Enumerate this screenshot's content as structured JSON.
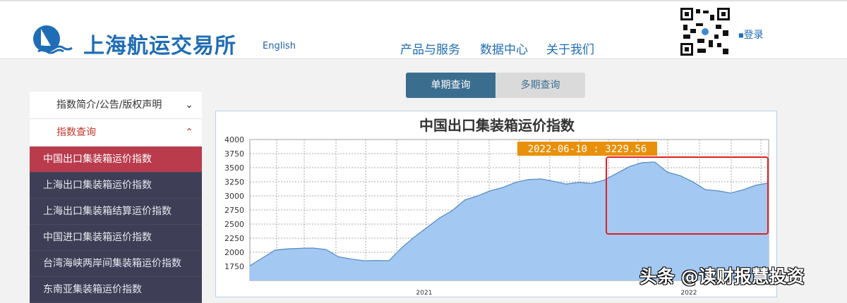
{
  "header": {
    "brand": "上海航运交易所",
    "english": "English",
    "nav": [
      "产品与服务",
      "数据中心",
      "关于我们"
    ],
    "login": "登录"
  },
  "tabs": [
    {
      "label": "单期查询",
      "active": true
    },
    {
      "label": "多期查询",
      "active": false
    }
  ],
  "sidebar": {
    "sections": [
      {
        "label": "指数简介/公告/版权声明",
        "expanded": false
      },
      {
        "label": "指数查询",
        "expanded": true
      }
    ],
    "items": [
      "中国出口集装箱运价指数",
      "上海出口集装箱运价指数",
      "上海出口集装箱结算运价指数",
      "中国进口集装箱运价指数",
      "台湾海峡两岸间集装箱运价指数",
      "东南亚集装箱运价指数"
    ],
    "active_index": 0
  },
  "colors": {
    "accent": "#1f6db5",
    "active_tab": "#3b6e8e",
    "sidebar_active": "#b93b4c",
    "sidebar_bg": "#3e3f57",
    "area_fill": "#a3c8f2",
    "tooltip": "#e8900c",
    "highlight": "#e02020"
  },
  "chart_data": {
    "type": "area",
    "title": "中国出口集装箱运价指数",
    "ylim": [
      1700,
      4000
    ],
    "yticks": [
      1750,
      2000,
      2250,
      2500,
      2750,
      3000,
      3250,
      3500,
      3750,
      4000
    ],
    "xtick_labels": [
      "2021",
      "2022"
    ],
    "tooltip": "2022-06-10 : 3229.56",
    "values": [
      1760,
      1900,
      2040,
      2060,
      2070,
      2075,
      2050,
      1920,
      1880,
      1850,
      1855,
      1850,
      2080,
      2270,
      2440,
      2610,
      2740,
      2930,
      3000,
      3090,
      3150,
      3240,
      3290,
      3300,
      3260,
      3210,
      3240,
      3220,
      3280,
      3400,
      3520,
      3590,
      3600,
      3420,
      3360,
      3250,
      3110,
      3090,
      3050,
      3110,
      3190,
      3229.56
    ],
    "highlight_range": "2022 recent period",
    "grid": true
  },
  "watermark": "头条 @读财报慧投资"
}
